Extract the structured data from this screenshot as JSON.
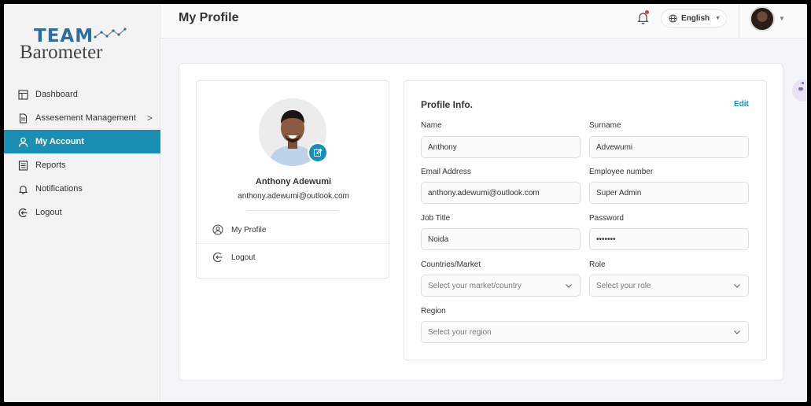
{
  "app": {
    "logo_team": "TEAM",
    "logo_barometer": "Barometer",
    "accent_color": "#1b8eb4"
  },
  "sidebar": {
    "items": [
      {
        "label": "Dashboard",
        "icon": "dashboard-icon"
      },
      {
        "label": "Assesement Management",
        "icon": "document-icon",
        "chevron": ">"
      },
      {
        "label": "My Account",
        "icon": "user-icon",
        "active": true
      },
      {
        "label": "Reports",
        "icon": "reports-icon"
      },
      {
        "label": "Notifications",
        "icon": "bell-icon"
      },
      {
        "label": "Logout",
        "icon": "logout-icon"
      }
    ]
  },
  "header": {
    "title": "My Profile",
    "language": "English"
  },
  "profile_card": {
    "name": "Anthony Adewumi",
    "email": "anthony.adewumi@outlook.com",
    "menu": [
      {
        "label": "My Profile",
        "icon": "profile-circle-icon"
      },
      {
        "label": "Logout",
        "icon": "logout-icon"
      }
    ]
  },
  "profile_info": {
    "title": "Profile Info.",
    "edit_label": "Edit",
    "fields": {
      "name": {
        "label": "Name",
        "value": "Anthony"
      },
      "surname": {
        "label": "Surname",
        "value": "Advewumi"
      },
      "email": {
        "label": "Email Address",
        "value": "anthony.adewumi@outlook.com"
      },
      "employee_number": {
        "label": "Employee number",
        "value": "Super Admin"
      },
      "job_title": {
        "label": "Job Title",
        "value": "Noida"
      },
      "password": {
        "label": "Password",
        "value": "•••••••"
      },
      "countries": {
        "label": "Countries/Market",
        "placeholder": "Select your market/country"
      },
      "role": {
        "label": "Role",
        "placeholder": "Select your role"
      },
      "region": {
        "label": "Region",
        "placeholder": "Select your region"
      }
    }
  }
}
